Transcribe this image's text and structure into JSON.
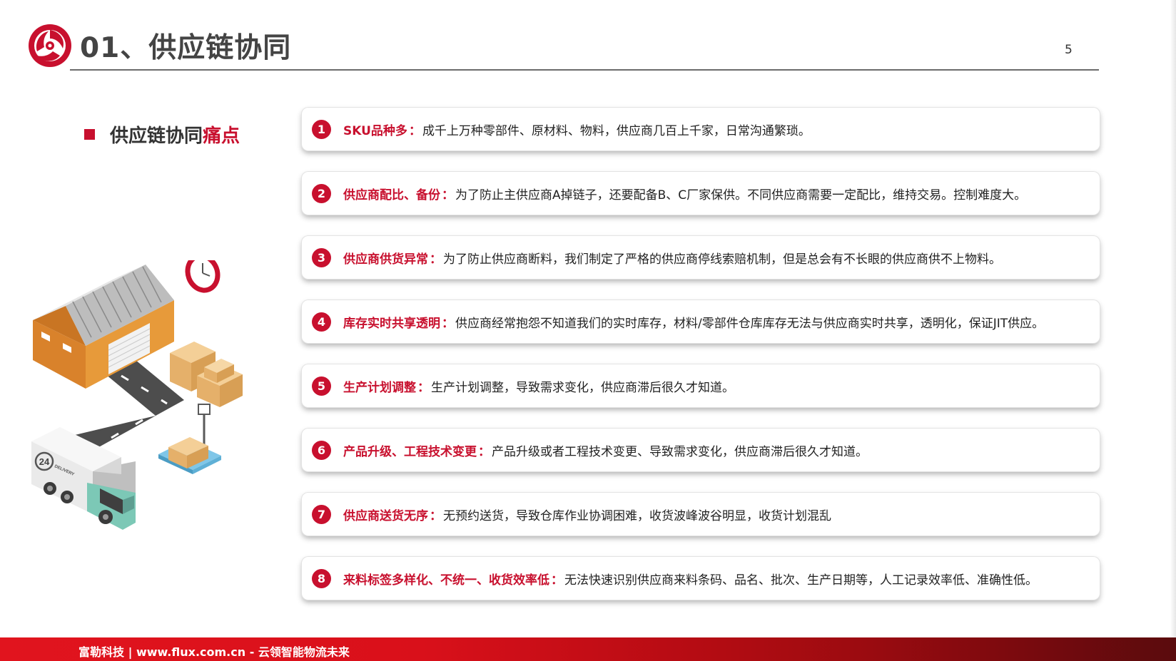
{
  "header": {
    "title": "01、供应链协同",
    "page_number": "5"
  },
  "section": {
    "title_plain": "供应链协同",
    "title_accent": "痛点"
  },
  "illustration": {
    "truck_badge_number": "24",
    "truck_badge_text": "DELIVERY"
  },
  "pain_points": [
    {
      "number": "1",
      "label": "SKU品种多",
      "separator": "：",
      "text": "成千上万种零部件、原材料、物料，供应商几百上千家，日常沟通繁琐。"
    },
    {
      "number": "2",
      "label": "供应商配比、备份",
      "separator": "：",
      "text": "为了防止主供应商A掉链子，还要配备B、C厂家保供。不同供应商需要一定配比，维持交易。控制难度大。"
    },
    {
      "number": "3",
      "label": "供应商供货异常",
      "separator": "：",
      "text": "为了防止供应商断料，我们制定了严格的供应商停线索赔机制，但是总会有不长眼的供应商供不上物料。"
    },
    {
      "number": "4",
      "label": "库存实时共享透明",
      "separator": "：",
      "text": "供应商经常抱怨不知道我们的实时库存，材料/零部件仓库库存无法与供应商实时共享，透明化，保证JIT供应。"
    },
    {
      "number": "5",
      "label": "生产计划调整",
      "separator": "：",
      "text": "生产计划调整，导致需求变化，供应商滞后很久才知道。"
    },
    {
      "number": "6",
      "label": "产品升级、工程技术变更",
      "separator": "：",
      "text": "产品升级或者工程技术变更、导致需求变化，供应商滞后很久才知道。"
    },
    {
      "number": "7",
      "label": "供应商送货无序",
      "separator": "：",
      "text": "无预约送货，导致仓库作业协调困难，收货波峰波谷明显，收货计划混乱"
    },
    {
      "number": "8",
      "label": "来料标签多样化、不统一、收货效率低",
      "separator": "：",
      "text": "无法快速识别供应商来料条码、品名、批次、生产日期等，人工记录效率低、准确性低。"
    }
  ],
  "footer": {
    "tagline": "富勒科技 | www.flux.com.cn  -  云领智能物流未来"
  },
  "colors": {
    "accent": "#c8102e",
    "title_gray": "#444444",
    "footer_red": "#e1141e",
    "footer_dark": "#5a0b0d"
  }
}
